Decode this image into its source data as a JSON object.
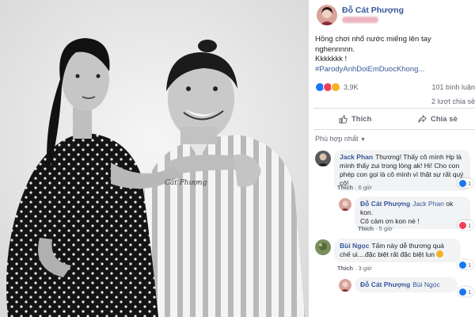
{
  "post": {
    "author": "Đỗ Cát Phượng",
    "caption_line1": "Hồng chơi nhổ nước miếng lên tay nghennnnn.",
    "caption_line2": "Kkkkkkk !",
    "hashtag": "#ParodyAnhDoiEmDuocKhong...",
    "reactions_count": "3,9K",
    "comments_count": "101 bình luận",
    "shares_count": "2 lượt chia sẻ",
    "like_button": "Thích",
    "share_button": "Chia sẻ",
    "sort_label": "Phù hợp nhất",
    "colors": {
      "link": "#385898",
      "like": "#1877f2",
      "love": "#f33e58",
      "haha": "#f7b125"
    }
  },
  "comments": [
    {
      "author": "Jack Phan",
      "text": "Thương! Thấy cô mình Hp là mình thấy zui trong lòng ak! Hi! Cho con phép con gọi là cô mình vì thật sự rất quý cô!",
      "like_label": "Thích",
      "time": "6 giờ",
      "reaction_count": "1"
    },
    {
      "author": "Đỗ Cát Phượng",
      "tag": "Jack Phan",
      "text_suffix": "ok kon.",
      "text_line2": "Cô cảm ơn kon nè !",
      "like_label": "Thích",
      "time": "5 giờ",
      "reaction_count": "1"
    },
    {
      "author": "Bùi Ngọc",
      "text": "Tấm này dễ thương quá chế ui....đặc biệt rất đặc biệt lun",
      "like_label": "Thích",
      "time": "3 giờ",
      "reaction_count": "1"
    },
    {
      "author": "Đỗ Cát Phượng",
      "tag": "Bùi Ngọc",
      "reaction_count": "1"
    }
  ],
  "photo": {
    "signature": "Cát Phượng",
    "icons": [
      "woman-figure",
      "man-figure",
      "polka-dot-dress",
      "striped-shirt"
    ]
  }
}
